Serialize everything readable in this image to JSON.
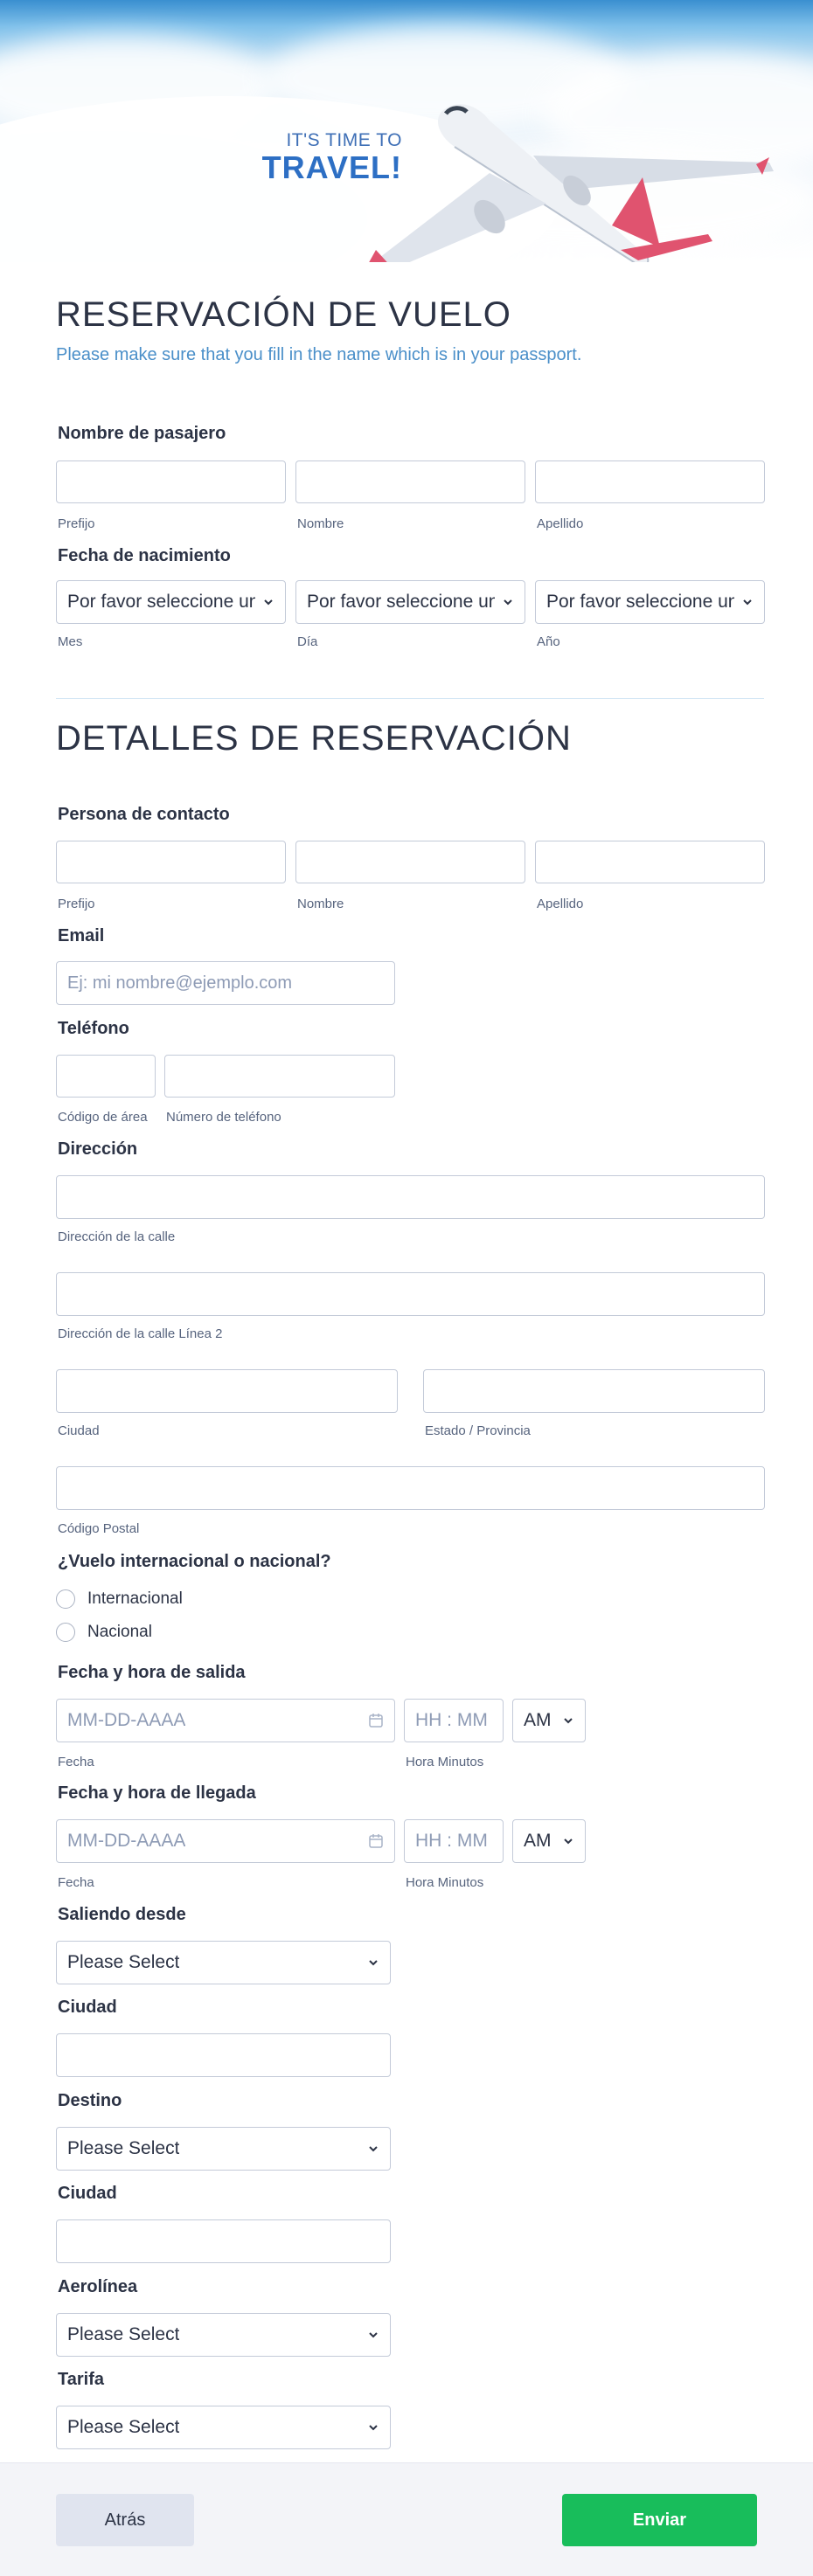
{
  "hero": {
    "slogan_small": "IT'S TIME TO",
    "slogan_big": "TRAVEL!"
  },
  "section1": {
    "title": "RESERVACIÓN DE VUELO",
    "subtitle": "Please make sure that you fill in the name which is in your passport.",
    "passenger_label": "Nombre de pasajero",
    "name_sublabels": [
      "Prefijo",
      "Nombre",
      "Apellido"
    ],
    "dob_label": "Fecha de nacimiento",
    "dob_placeholder": "Por favor seleccione un",
    "dob_sublabels": [
      "Mes",
      "Día",
      "Año"
    ]
  },
  "section2": {
    "title": "DETALLES DE RESERVACIÓN",
    "contact_label": "Persona de contacto",
    "contact_sublabels": [
      "Prefijo",
      "Nombre",
      "Apellido"
    ],
    "email_label": "Email",
    "email_placeholder": "Ej: mi nombre@ejemplo.com",
    "phone_label": "Teléfono",
    "phone_sublabels": [
      "Código de área",
      "Número de teléfono"
    ],
    "address_label": "Dirección",
    "address_sublabels": [
      "Dirección de la calle",
      "Dirección de la calle Línea 2",
      "Ciudad",
      "Estado / Provincia",
      "Código Postal"
    ],
    "flight_type_label": "¿Vuelo internacional o nacional?",
    "flight_type_options": [
      "Internacional",
      "Nacional"
    ],
    "departure_label": "Fecha y hora de salida",
    "arrival_label": "Fecha y hora de llegada",
    "date_placeholder": "MM-DD-AAAA",
    "time_placeholder": "HH : MM",
    "ampm_value": "AM",
    "date_sublabel": "Fecha",
    "time_sublabel": "Hora Minutos",
    "from_label": "Saliendo desde",
    "city_label": "Ciudad",
    "dest_label": "Destino",
    "airline_label": "Aerolínea",
    "fare_label": "Tarifa",
    "select_placeholder": "Please Select"
  },
  "footer": {
    "back": "Atrás",
    "submit": "Enviar"
  },
  "colors": {
    "accent": "#2d6fc4",
    "submit": "#18bd5b",
    "back": "#e0e4ef"
  }
}
